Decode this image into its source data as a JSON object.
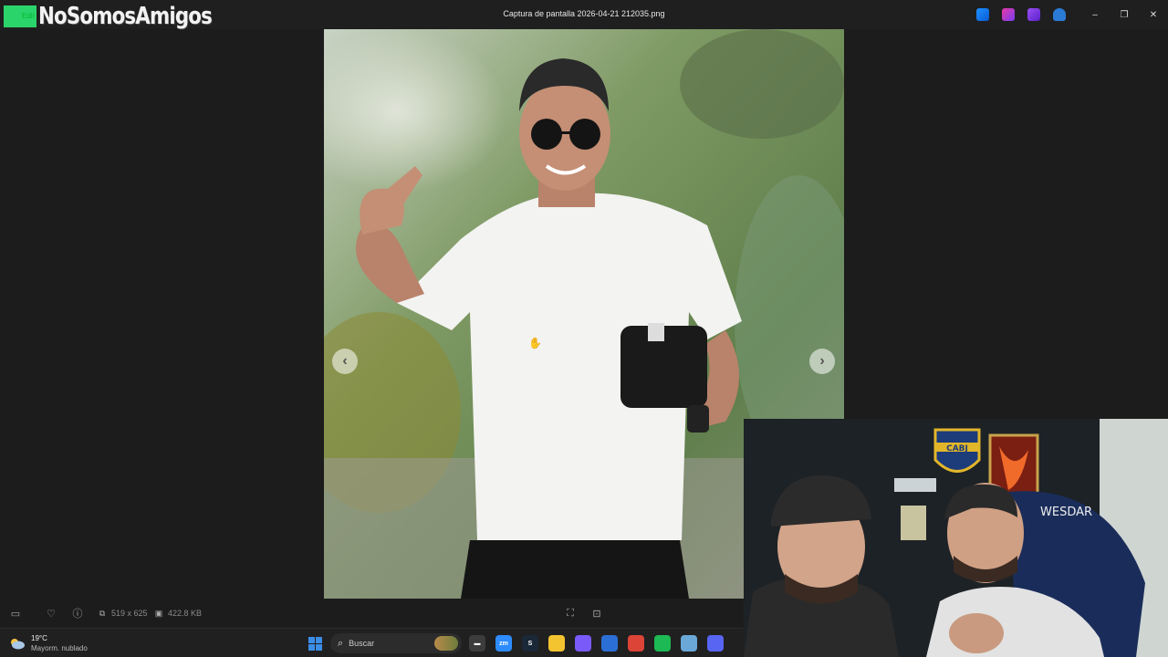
{
  "app": {
    "channel_logo_text": "NoSomosAmigos",
    "channel_logo_badge": "Edit",
    "window_title": "Captura de pantalla 2026-04-21 212035.png",
    "window_controls": {
      "minimize": "–",
      "maximize": "❐",
      "close": "✕"
    }
  },
  "viewer": {
    "prev_arrow": "‹",
    "next_arrow": "›"
  },
  "infobar": {
    "dimensions": "519 x 625",
    "file_size": "422.8 KB"
  },
  "taskbar": {
    "weather_temp": "19°C",
    "weather_desc": "Mayorm. nublado",
    "search_placeholder": "Buscar",
    "apps": [
      {
        "name": "file-explorer-icon",
        "color": "#3c3c3c",
        "label": "▬"
      },
      {
        "name": "zoom-icon",
        "color": "#2d8cff",
        "label": "zm"
      },
      {
        "name": "steam-icon",
        "color": "#1b2838",
        "label": "S"
      },
      {
        "name": "folder-icon",
        "color": "#f4c430",
        "label": ""
      },
      {
        "name": "copilot-icon",
        "color": "#7a5af8",
        "label": ""
      },
      {
        "name": "store-icon",
        "color": "#2b6fd6",
        "label": ""
      },
      {
        "name": "chrome-icon",
        "color": "#db4437",
        "label": ""
      },
      {
        "name": "spotify-icon",
        "color": "#1db954",
        "label": ""
      },
      {
        "name": "remote-icon",
        "color": "#6aa8d8",
        "label": ""
      },
      {
        "name": "discord-icon",
        "color": "#5865f2",
        "label": ""
      }
    ]
  },
  "webcam": {
    "shield_text": "CABJ",
    "chair_brand": "WESDAR"
  },
  "colors": {
    "background": "#1c1c1c",
    "titlebar": "#1f1f1f",
    "taskbar": "#202020",
    "logo_green": "#2bd46a"
  }
}
